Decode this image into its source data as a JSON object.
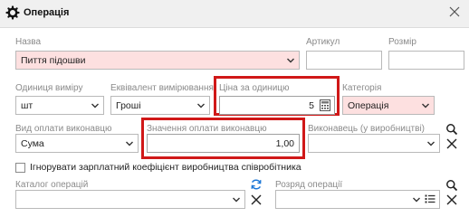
{
  "window": {
    "title": "Операція"
  },
  "fields": {
    "name": {
      "label": "Назва",
      "value": "Пиття підошви"
    },
    "article": {
      "label": "Артикул",
      "value": ""
    },
    "size": {
      "label": "Розмір",
      "value": ""
    },
    "unit": {
      "label": "Одиниця виміру",
      "value": "шт"
    },
    "equivalent": {
      "label": "Еквівалент вимірювання",
      "value": "Гроші"
    },
    "unit_price": {
      "label": "Ціна за одиницю",
      "value": "5"
    },
    "category": {
      "label": "Категорія",
      "value": "Операція"
    },
    "payment_type": {
      "label": "Вид оплати виконавцю",
      "value": "Сума"
    },
    "payment_value": {
      "label": "Значення оплати виконавцю",
      "value": "1,00"
    },
    "executor": {
      "label": "Виконавець (у виробництві)",
      "value": ""
    },
    "catalog": {
      "label": "Каталог операцій",
      "value": ""
    },
    "grade": {
      "label": "Розряд операції",
      "value": ""
    }
  },
  "checkbox": {
    "label": "Ігнорувати зарплатний коефіцієнт виробництва співробітника",
    "checked": false
  },
  "colors": {
    "required_bg": "#fde0e0",
    "highlight": "#d01818",
    "accent": "#1e78d7"
  },
  "icons": [
    "gear-icon",
    "close-icon",
    "chevron-down-icon",
    "calculator-icon",
    "search-icon",
    "clear-icon",
    "refresh-icon",
    "list-icon"
  ]
}
